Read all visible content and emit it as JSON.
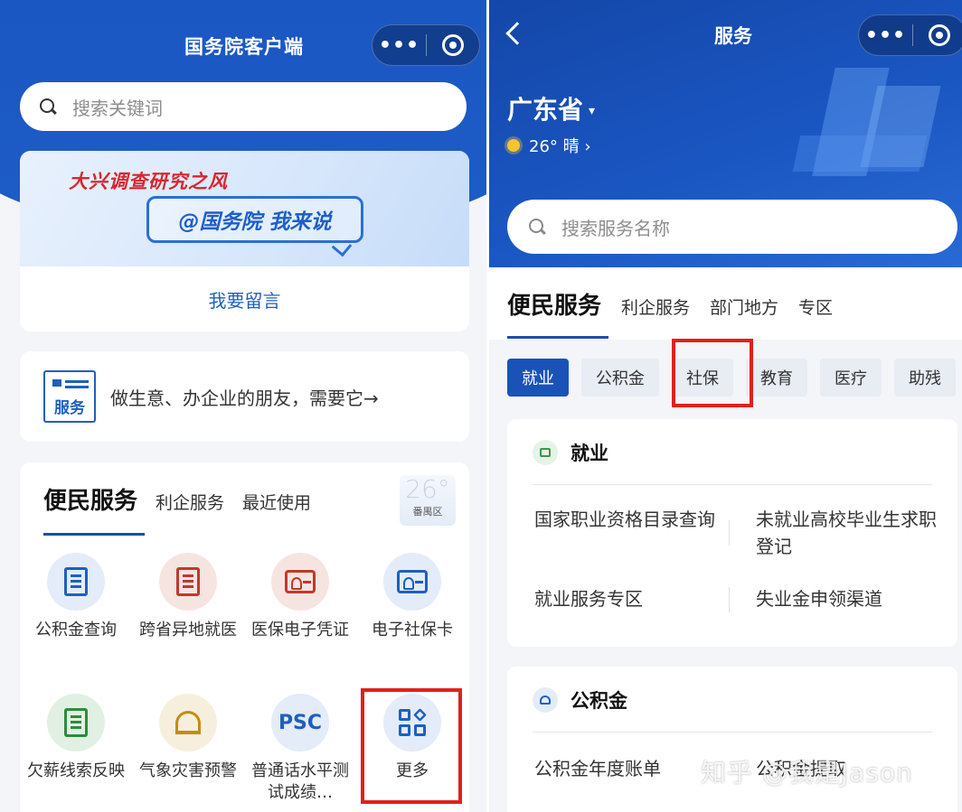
{
  "left": {
    "header": {
      "title": "国务院客户端",
      "menu_dots": "•••"
    },
    "search": {
      "placeholder": "搜索关键词"
    },
    "banner": {
      "slogan": "大兴调查研究之风",
      "bubble": "@国务院 我来说",
      "link": "我要留言"
    },
    "service_banner": {
      "icon_label": "服务",
      "text": "做生意、办企业的朋友，需要它→"
    },
    "tabs": {
      "main": "便民服务",
      "items": [
        "利企服务",
        "最近使用"
      ]
    },
    "weather": {
      "temp": "26°",
      "district": "番禺区"
    },
    "grid": [
      {
        "label": "公积金查询",
        "icon": "doc-yen-icon",
        "color": "blue"
      },
      {
        "label": "跨省异地就医",
        "icon": "doc-plus-icon",
        "color": "red"
      },
      {
        "label": "医保电子凭证",
        "icon": "id-card-icon",
        "color": "red"
      },
      {
        "label": "电子社保卡",
        "icon": "card-icon",
        "color": "blue"
      },
      {
        "label": "欠薪线索反映",
        "icon": "doc-yen-icon",
        "color": "green"
      },
      {
        "label": "气象灾害预警",
        "icon": "alarm-light-icon",
        "color": "yellow"
      },
      {
        "label": "普通话水平测试成绩…",
        "icon": "psc-icon",
        "icon_text": "PSC",
        "color": "blue"
      },
      {
        "label": "更多",
        "icon": "apps-grid-icon",
        "color": "blue"
      }
    ]
  },
  "right": {
    "header": {
      "title": "服务",
      "menu_dots": "•••"
    },
    "province": "广东省",
    "caret": "▾",
    "weather": "26° 晴 ›",
    "search": {
      "placeholder": "搜索服务名称"
    },
    "tabs": {
      "main": "便民服务",
      "items": [
        "利企服务",
        "部门地方",
        "专区"
      ]
    },
    "chips": [
      "就业",
      "公积金",
      "社保",
      "教育",
      "医疗",
      "助残"
    ],
    "categories": [
      {
        "name": "就业",
        "items": [
          "国家职业资格目录查询",
          "未就业高校毕业生求职登记",
          "就业服务专区",
          "失业金申领渠道"
        ]
      },
      {
        "name": "公积金",
        "items": [
          "公积金年度账单",
          "公积金提取"
        ]
      }
    ],
    "watermark": "知乎 @我是Jason"
  },
  "colors": {
    "brand_blue": "#1a56c2",
    "highlight_red": "#e0211b",
    "active_chip": "#1a52b8"
  }
}
